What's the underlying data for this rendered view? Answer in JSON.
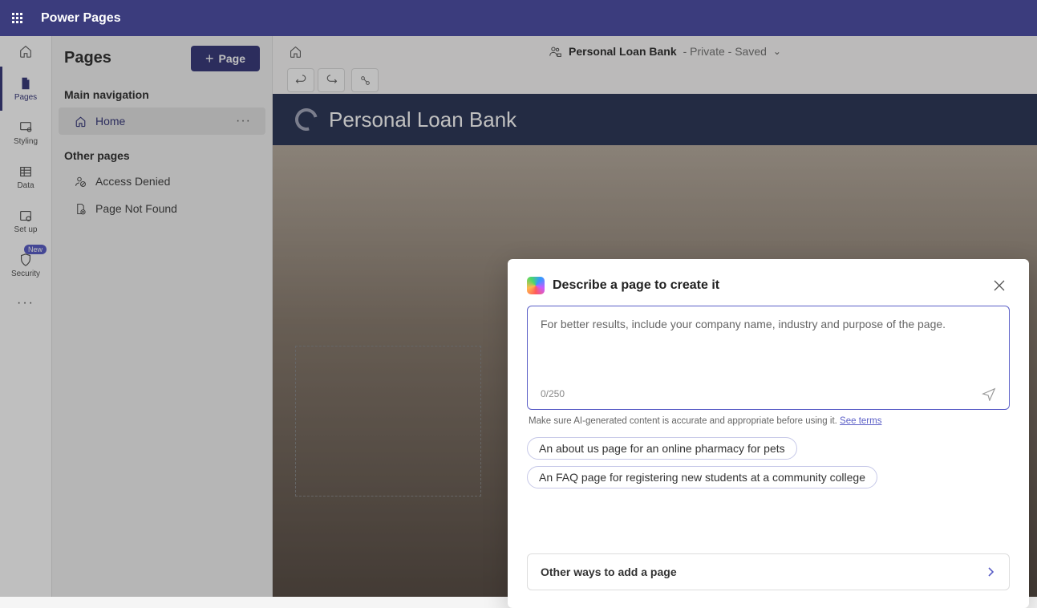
{
  "app_title": "Power Pages",
  "rail": [
    {
      "label": "Pages"
    },
    {
      "label": "Styling"
    },
    {
      "label": "Data"
    },
    {
      "label": "Set up"
    },
    {
      "label": "Security",
      "badge": "New"
    }
  ],
  "side": {
    "title": "Pages",
    "add_button": "Page",
    "main_nav_h": "Main navigation",
    "home_item": "Home",
    "other_h": "Other pages",
    "other_items": [
      "Access Denied",
      "Page Not Found"
    ]
  },
  "crumb": {
    "site_name": "Personal Loan Bank",
    "status": "- Private - Saved"
  },
  "site_header": "Personal Loan Bank",
  "modal": {
    "title": "Describe a page to create it",
    "placeholder": "For better results, include your company name, industry and purpose of the page.",
    "counter": "0/250",
    "disclaimer": "Make sure AI-generated content is accurate and appropriate before using it. ",
    "see_terms": "See terms",
    "suggestions": [
      "An about us page for an online pharmacy for pets",
      "An FAQ page for registering new students at a community college"
    ],
    "other_ways": "Other ways to add a page"
  }
}
